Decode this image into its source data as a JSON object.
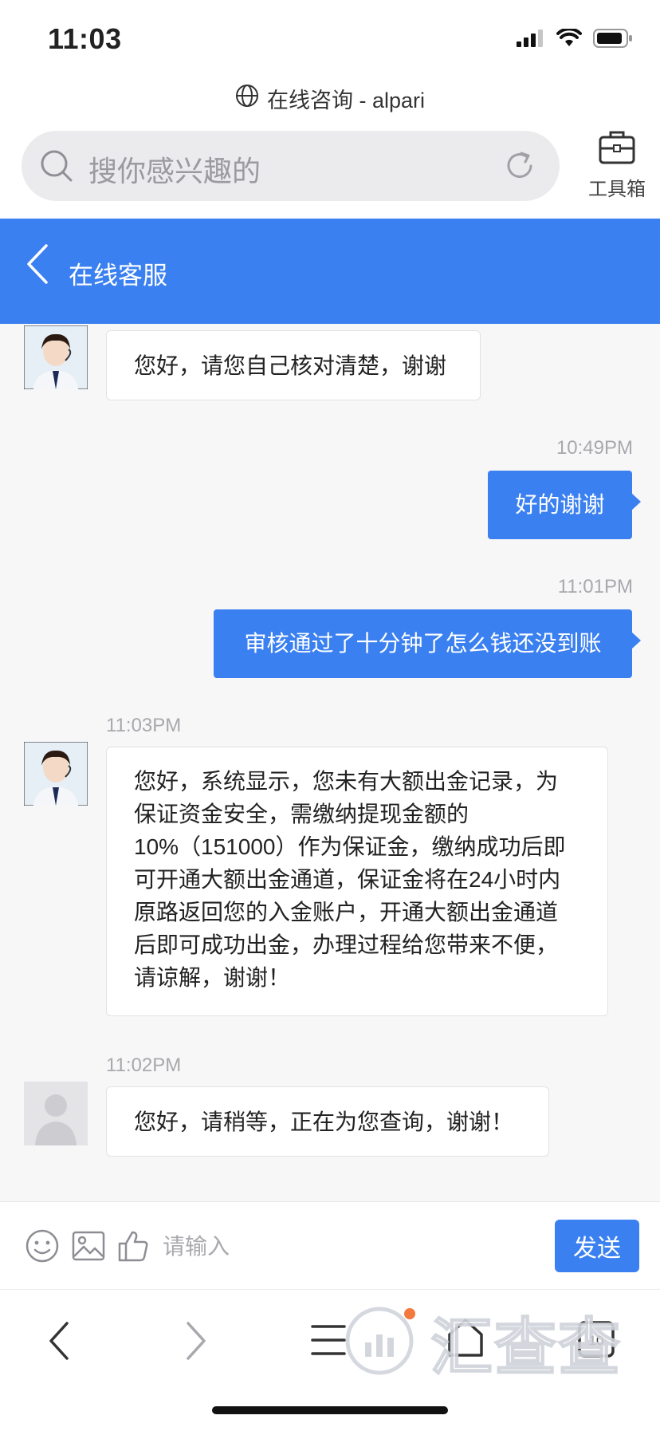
{
  "status_bar": {
    "time": "11:03"
  },
  "browser": {
    "page_title": "在线咨询 - alpari",
    "search_placeholder": "搜你感兴趣的",
    "toolbox_label": "工具箱"
  },
  "header": {
    "title": "在线客服"
  },
  "messages": [
    {
      "direction": "in",
      "avatar": "agent-photo-avatar",
      "text": "您好，请您自己核对清楚，谢谢"
    },
    {
      "direction": "out",
      "time": "10:49PM",
      "text": "好的谢谢"
    },
    {
      "direction": "out",
      "time": "11:01PM",
      "text": "审核通过了十分钟了怎么钱还没到账"
    },
    {
      "direction": "in",
      "time": "11:03PM",
      "avatar": "agent-photo-avatar",
      "lines": [
        "您好，系统显示，您未有大额出金记录，为",
        "保证资金安全，需缴纳提现金额的",
        "10%（151000）作为保证金，缴纳成功后即",
        "可开通大额出金通道，保证金将在24小时内",
        "原路返回您的入金账户，开通大额出金通道",
        "后即可成功出金，办理过程给您带来不便，",
        "请谅解，谢谢！"
      ]
    },
    {
      "direction": "in",
      "time": "11:02PM",
      "avatar": "default-user-avatar",
      "text": "您好，请稍等，正在为您查询，谢谢！"
    }
  ],
  "input_bar": {
    "placeholder": "请输入",
    "send_label": "发送",
    "icons": [
      "emoji-icon",
      "image-icon",
      "thumbs-up-icon"
    ]
  },
  "browser_nav": {
    "icons": [
      "back-icon",
      "forward-icon",
      "menu-icon",
      "home-icon",
      "tabs-icon"
    ],
    "tabs_count": "10",
    "watermark": "汇查查"
  },
  "colors": {
    "accent": "#3a80f0",
    "background": "#f7f7f8"
  }
}
